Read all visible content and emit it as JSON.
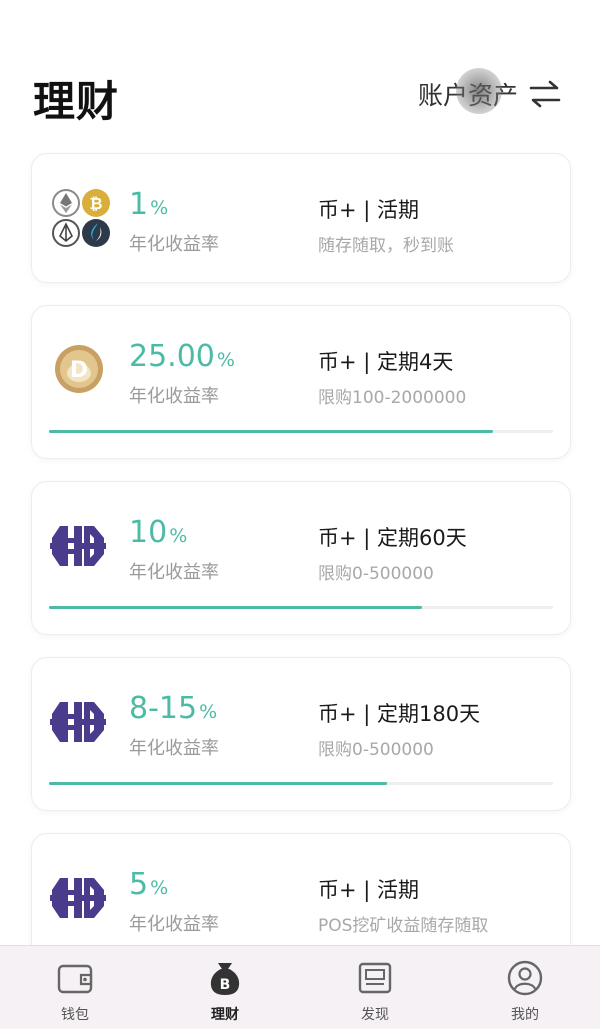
{
  "header": {
    "title": "理财",
    "asset_link": "账户资产"
  },
  "cards": [
    {
      "coin": "multi-coin-icon",
      "rate": "1",
      "rate_unit": "%",
      "rate_label": "年化收益率",
      "title": "币+ | 活期",
      "subtitle": "随存随取，秒到账"
    },
    {
      "coin": "doge-coin-icon",
      "rate": "25.00",
      "rate_unit": "%",
      "rate_label": "年化收益率",
      "title": "币+ | 定期4天",
      "subtitle": "限购100-2000000",
      "progress": 0.88
    },
    {
      "coin": "hc-coin-icon",
      "rate": "10",
      "rate_unit": "%",
      "rate_label": "年化收益率",
      "title": "币+ | 定期60天",
      "subtitle": "限购0-500000",
      "progress": 0.74
    },
    {
      "coin": "hc-coin-icon",
      "rate": "8-15",
      "rate_unit": "%",
      "rate_label": "年化收益率",
      "title": "币+ | 定期180天",
      "subtitle": "限购0-500000",
      "progress": 0.67
    },
    {
      "coin": "hc-coin-icon",
      "rate": "5",
      "rate_unit": "%",
      "rate_label": "年化收益率",
      "title": "币+ | 活期",
      "subtitle": "POS挖矿收益随存随取"
    }
  ],
  "tabs": [
    {
      "label": "钱包",
      "icon": "wallet-icon"
    },
    {
      "label": "理财",
      "icon": "money-bag-icon",
      "active": true
    },
    {
      "label": "发现",
      "icon": "discover-icon"
    },
    {
      "label": "我的",
      "icon": "profile-icon"
    }
  ],
  "colors": {
    "accent": "#4cbba6",
    "hc_purple": "#4a3b8c",
    "tabbar_bg": "#f6f1f4"
  }
}
